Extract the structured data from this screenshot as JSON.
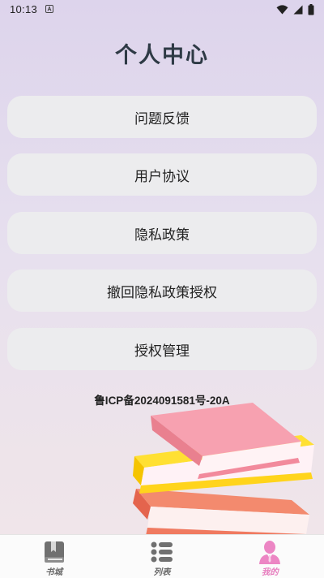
{
  "status_bar": {
    "time": "10:13",
    "icons": [
      "notification-a-icon",
      "wifi-icon",
      "signal-icon",
      "battery-icon"
    ]
  },
  "page": {
    "title": "个人中心"
  },
  "menu": {
    "items": [
      {
        "label": "问题反馈"
      },
      {
        "label": "用户协议"
      },
      {
        "label": "隐私政策"
      },
      {
        "label": "撤回隐私政策授权"
      },
      {
        "label": "授权管理"
      }
    ]
  },
  "footer": {
    "icp": "鲁ICP备2024091581号-20A"
  },
  "bottom_nav": {
    "items": [
      {
        "label": "书城",
        "icon": "book-icon",
        "active": false
      },
      {
        "label": "列表",
        "icon": "list-icon",
        "active": false
      },
      {
        "label": "我的",
        "icon": "person-icon",
        "active": true
      }
    ]
  },
  "colors": {
    "background_top": "#ddd4ec",
    "background_bottom": "#f1e6ea",
    "card": "#ececee",
    "title": "#2e3a45",
    "active_nav": "#e77fbf",
    "inactive_nav": "#6a6a6a"
  }
}
